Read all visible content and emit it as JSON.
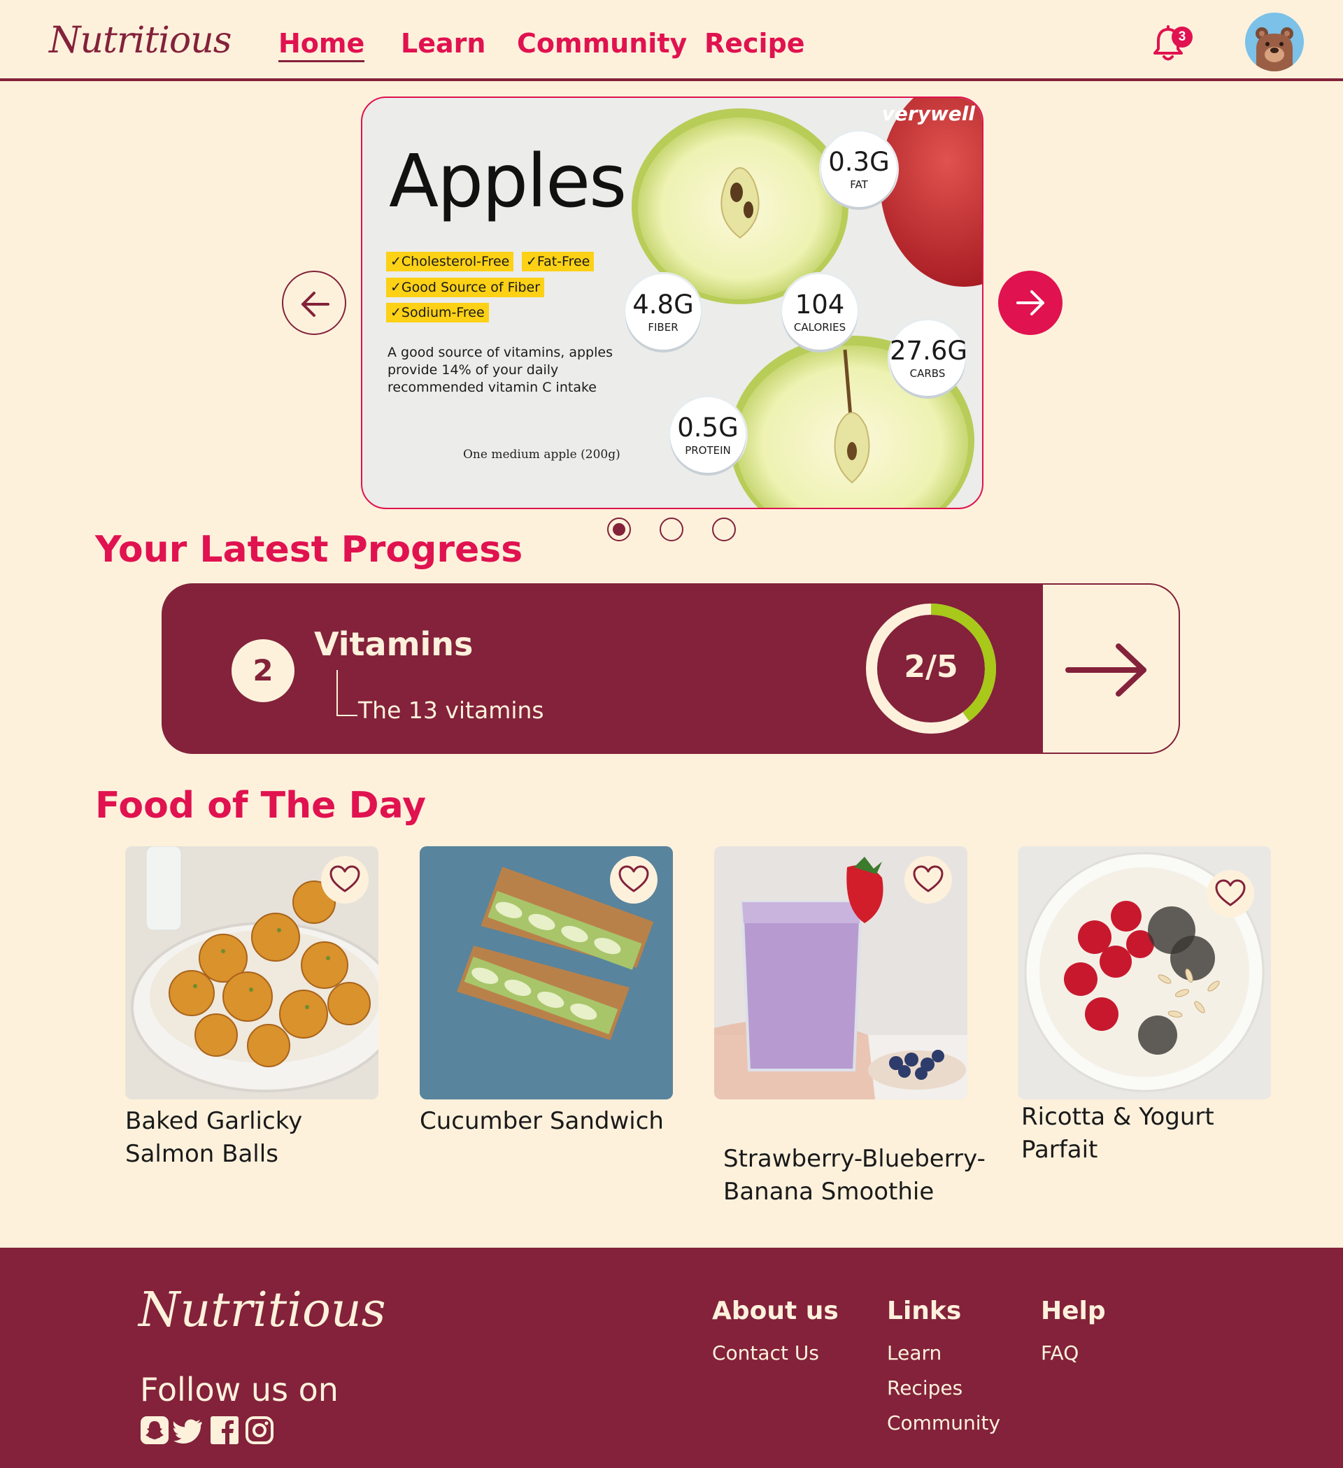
{
  "header": {
    "logo": "Nutritious",
    "nav": [
      "Home",
      "Learn",
      "Community",
      "Recipe"
    ],
    "active_nav": "Home",
    "notification_count": "3"
  },
  "carousel": {
    "brand": "verywell",
    "title": "Apples",
    "tags": [
      "✓Cholesterol-Free",
      "✓Fat-Free",
      "✓Good Source of Fiber",
      "✓Sodium-Free"
    ],
    "description": "A good source of vitamins, apples provide 14% of your daily recommended vitamin C intake",
    "serving": "One medium apple (200g)",
    "nutrients": [
      {
        "value": "0.3G",
        "label": "FAT"
      },
      {
        "value": "4.8G",
        "label": "FIBER"
      },
      {
        "value": "104",
        "label": "CALORIES"
      },
      {
        "value": "27.6G",
        "label": "CARBS"
      },
      {
        "value": "0.5G",
        "label": "PROTEIN"
      }
    ],
    "active_slide": 1,
    "slide_count": 3
  },
  "progress": {
    "section_title": "Your Latest Progress",
    "lesson_number": "2",
    "lesson_title": "Vitamins",
    "lesson_subtitle": "The 13 vitamins",
    "progress_text": "2/5",
    "progress_fraction": 0.4,
    "colors": {
      "card": "#83223A",
      "ring_track": "#FDF1DC",
      "ring_fill": "#A8C81A"
    }
  },
  "food": {
    "section_title": "Food of The Day",
    "items": [
      {
        "name": "Baked Garlicky Salmon Balls"
      },
      {
        "name": "Cucumber Sandwich"
      },
      {
        "name": "Strawberry-Blueberry-Banana Smoothie"
      },
      {
        "name": "Ricotta & Yogurt Parfait"
      }
    ]
  },
  "footer": {
    "logo": "Nutritious",
    "follow": "Follow us on",
    "social_icons": [
      "snapchat-icon",
      "twitter-icon",
      "facebook-icon",
      "instagram-icon"
    ],
    "columns": [
      {
        "heading": "About us",
        "links": [
          "Contact Us"
        ]
      },
      {
        "heading": "Links",
        "links": [
          "Learn",
          "Recipes",
          "Community"
        ]
      },
      {
        "heading": "Help",
        "links": [
          "FAQ"
        ]
      }
    ]
  },
  "colors": {
    "background": "#FDF1DC",
    "accent": "#E0124F",
    "brand": "#83223A"
  }
}
